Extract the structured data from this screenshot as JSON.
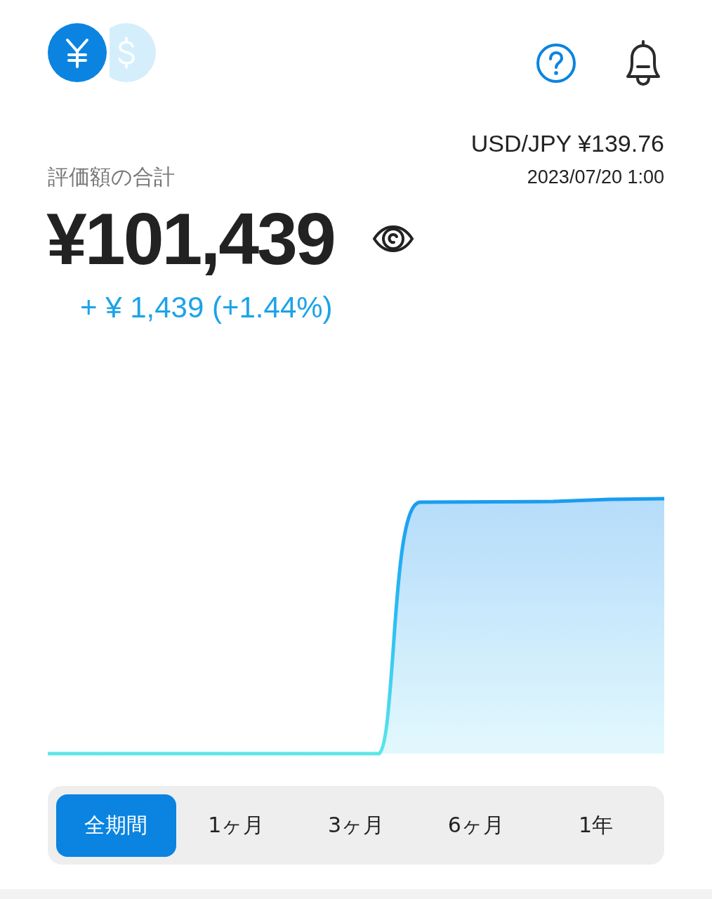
{
  "currencies": [
    {
      "kind": "yen",
      "selected": true
    },
    {
      "kind": "dollar",
      "selected": false
    }
  ],
  "rate": {
    "pair": "USD/JPY ¥139.76",
    "time": "2023/07/20 1:00"
  },
  "total": {
    "label": "評価額の合計",
    "amount": "¥101,439",
    "change": "+ ¥ 1,439 (+1.44%)"
  },
  "periods": [
    {
      "label": "全期間",
      "selected": true
    },
    {
      "label": "1ヶ月",
      "selected": false
    },
    {
      "label": "3ヶ月",
      "selected": false
    },
    {
      "label": "6ヶ月",
      "selected": false
    },
    {
      "label": "1年",
      "selected": false
    }
  ]
}
